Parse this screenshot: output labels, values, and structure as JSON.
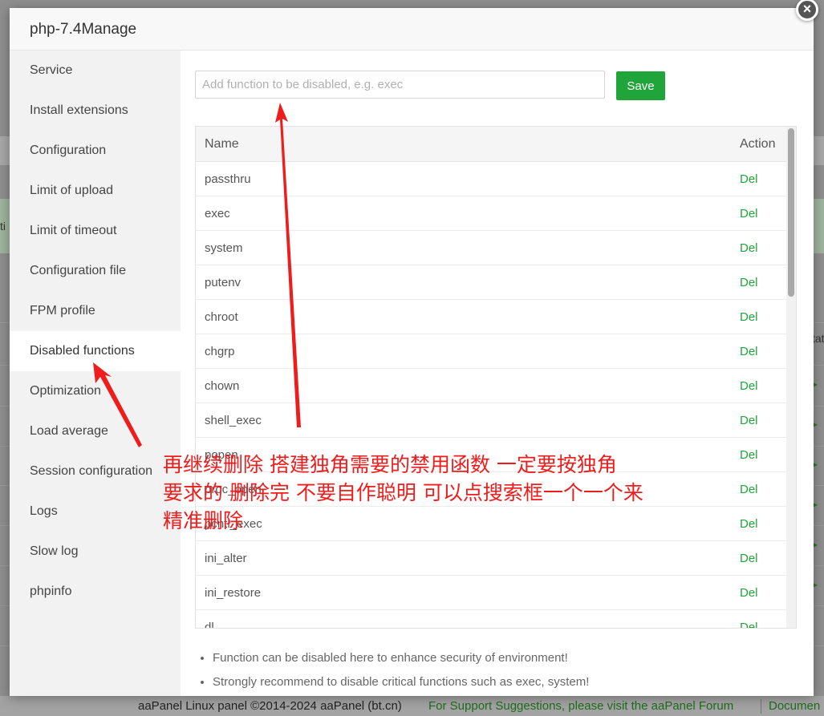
{
  "background": {
    "fragment_left": "ti",
    "fragment_right": "tat",
    "footer": {
      "copyright": "aaPanel Linux panel ©2014-2024 aaPanel (bt.cn)",
      "forum": "For Support Suggestions, please visit the aaPanel Forum",
      "docs": "Documen"
    }
  },
  "modal": {
    "title": "php-7.4Manage",
    "close_icon": "×",
    "sidebar": {
      "items": [
        {
          "label": "Service"
        },
        {
          "label": "Install extensions"
        },
        {
          "label": "Configuration"
        },
        {
          "label": "Limit of upload"
        },
        {
          "label": "Limit of timeout"
        },
        {
          "label": "Configuration file"
        },
        {
          "label": "FPM profile"
        },
        {
          "label": "Disabled functions",
          "active": true
        },
        {
          "label": "Optimization"
        },
        {
          "label": "Load average"
        },
        {
          "label": "Session configuration"
        },
        {
          "label": "Logs"
        },
        {
          "label": "Slow log"
        },
        {
          "label": "phpinfo"
        }
      ]
    },
    "form": {
      "placeholder": "Add function to be disabled, e.g. exec",
      "value": "",
      "save_label": "Save"
    },
    "table": {
      "columns": [
        "Name",
        "Action"
      ],
      "rows": [
        {
          "name": "passthru",
          "action": "Del"
        },
        {
          "name": "exec",
          "action": "Del"
        },
        {
          "name": "system",
          "action": "Del"
        },
        {
          "name": "putenv",
          "action": "Del"
        },
        {
          "name": "chroot",
          "action": "Del"
        },
        {
          "name": "chgrp",
          "action": "Del"
        },
        {
          "name": "chown",
          "action": "Del"
        },
        {
          "name": "shell_exec",
          "action": "Del"
        },
        {
          "name": "popen",
          "action": "Del"
        },
        {
          "name": "proc_open",
          "action": "Del"
        },
        {
          "name": "pcntl_exec",
          "action": "Del"
        },
        {
          "name": "ini_alter",
          "action": "Del"
        },
        {
          "name": "ini_restore",
          "action": "Del"
        },
        {
          "name": "dl",
          "action": "Del"
        }
      ]
    },
    "notes": [
      "Function can be disabled here to enhance security of environment!",
      "Strongly recommend to disable critical functions such as exec, system!"
    ]
  },
  "annotation": {
    "text": "再继续删除  搭建独角需要的禁用函数  一定要按独角\n要求的  删除完  不要自作聪明  可以点搜索框一个一个来\n精准删除",
    "color": "#ef1c1c"
  },
  "colors": {
    "accent_green": "#20a53a",
    "action_green": "#20a53a",
    "annotation_red": "#ef1c1c"
  }
}
